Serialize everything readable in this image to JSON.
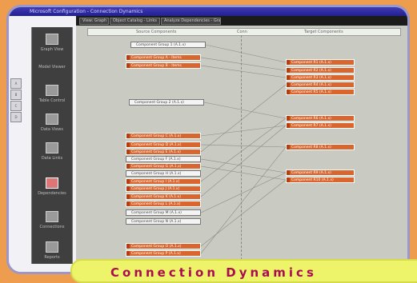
{
  "window": {
    "title": "Connection Dynamics",
    "title_bar_text": "Microsoft Configuration - Connection Dynamics"
  },
  "toolbar": {
    "field1": "View: Graph",
    "field2": "Object Catalog - Links",
    "field3": "Analyze Dependencies - Graph"
  },
  "canvas": {
    "column_header_left": "Source Components",
    "column_header_mid": "Conn",
    "column_header_right": "Target Components"
  },
  "sidebar": {
    "items": [
      {
        "label": "Graph View",
        "selected": false
      },
      {
        "label": "Model Viewer",
        "selected": false
      },
      {
        "label": "Table Control",
        "selected": false
      },
      {
        "label": "Data Views",
        "selected": false
      },
      {
        "label": "Data Links",
        "selected": false
      },
      {
        "label": "Dependencies",
        "selected": true
      },
      {
        "label": "Connections",
        "selected": false
      },
      {
        "label": "Reports",
        "selected": false
      }
    ],
    "tabs": [
      "A",
      "B",
      "C",
      "D"
    ]
  },
  "nodes_left": [
    {
      "label": "Component Group 1 (A.1.x)",
      "color": "white"
    },
    {
      "label": "Component Group A - Items",
      "color": "orange"
    },
    {
      "label": "Component Group B - Items",
      "color": "orange"
    },
    {
      "label": "Component Group 2 (A.1.x)",
      "color": "white"
    },
    {
      "label": "Component Group C (A.1.x)",
      "color": "orange"
    },
    {
      "label": "Component Group D (A.1.x)",
      "color": "orange"
    },
    {
      "label": "Component Group E (A.1.x)",
      "color": "orange"
    },
    {
      "label": "Component Group F (A.1.x)",
      "color": "white"
    },
    {
      "label": "Component Group G (A.1.x)",
      "color": "orange"
    },
    {
      "label": "Component Group H (A.1.x)",
      "color": "white"
    },
    {
      "label": "Component Group I (A.1.x)",
      "color": "orange"
    },
    {
      "label": "Component Group J (A.1.x)",
      "color": "orange"
    },
    {
      "label": "Component Group K (A.1.x)",
      "color": "orange"
    },
    {
      "label": "Component Group L (A.1.x)",
      "color": "orange"
    },
    {
      "label": "Component Group M (A.1.x)",
      "color": "white"
    },
    {
      "label": "Component Group N (A.1.x)",
      "color": "white"
    },
    {
      "label": "Component Group O (A.1.x)",
      "color": "orange"
    },
    {
      "label": "Component Group P (A.1.x)",
      "color": "orange"
    }
  ],
  "nodes_right": [
    {
      "label": "Component R1 (A.1.x)",
      "color": "orange"
    },
    {
      "label": "Component R2 (A.1.x)",
      "color": "orange"
    },
    {
      "label": "Component R3 (A.1.x)",
      "color": "orange"
    },
    {
      "label": "Component R4 (A.1.x)",
      "color": "orange"
    },
    {
      "label": "Component R5 (A.1.x)",
      "color": "orange"
    },
    {
      "label": "Component R6 (A.1.x)",
      "color": "orange"
    },
    {
      "label": "Component R7 (A.1.x)",
      "color": "orange"
    },
    {
      "label": "Component R8 (A.1.x)",
      "color": "orange"
    },
    {
      "label": "Component R9 (A.1.x)",
      "color": "orange"
    },
    {
      "label": "Component R10 (A.1.x)",
      "color": "orange"
    }
  ],
  "banner": {
    "text": "Connection Dynamics"
  },
  "colors": {
    "background": "#ee9d4e",
    "node_orange": "#d9662e",
    "banner_bg": "#eef46a",
    "banner_text": "#a90d50"
  }
}
